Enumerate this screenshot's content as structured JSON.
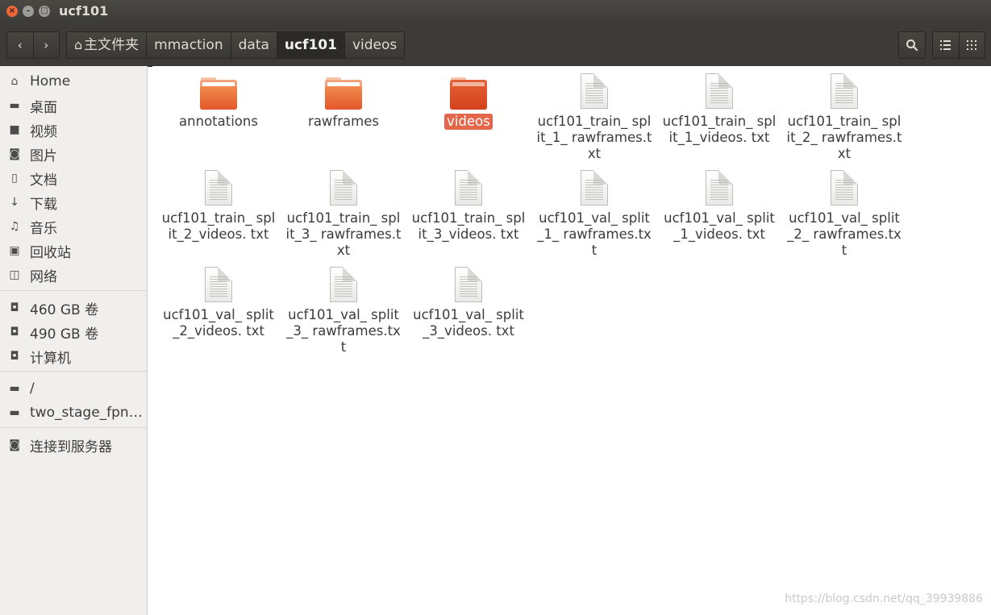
{
  "window": {
    "title": "ucf101",
    "buttons": {
      "close": "×",
      "minimize": "–",
      "maximize": "□"
    }
  },
  "toolbar": {
    "back_icon": "‹",
    "forward_icon": "›",
    "breadcrumb": [
      {
        "label": "主文件夹",
        "icon": "home-icon"
      },
      {
        "label": "mmaction"
      },
      {
        "label": "data"
      },
      {
        "label": "ucf101",
        "active": true
      },
      {
        "label": "videos"
      }
    ],
    "search_icon": "search-icon",
    "view_list_icon": "list-view-icon",
    "view_grid_icon": "grid-view-icon"
  },
  "sidebar": {
    "places": [
      {
        "label": "Home",
        "icon": "home-icon"
      },
      {
        "label": "桌面",
        "icon": "folder-icon"
      },
      {
        "label": "视频",
        "icon": "video-icon"
      },
      {
        "label": "图片",
        "icon": "camera-icon"
      },
      {
        "label": "文档",
        "icon": "document-icon"
      },
      {
        "label": "下载",
        "icon": "download-icon"
      },
      {
        "label": "音乐",
        "icon": "music-icon"
      },
      {
        "label": "回收站",
        "icon": "trash-icon"
      },
      {
        "label": "网络",
        "icon": "network-icon"
      }
    ],
    "devices": [
      {
        "label": "460 GB 卷",
        "icon": "drive-icon"
      },
      {
        "label": "490 GB 卷",
        "icon": "drive-icon"
      },
      {
        "label": "计算机",
        "icon": "drive-icon"
      }
    ],
    "bookmarks": [
      {
        "label": "/",
        "icon": "folder-icon"
      },
      {
        "label": "two_stage_fpn…",
        "icon": "folder-icon"
      }
    ],
    "connect": {
      "label": "连接到服务器",
      "icon": "server-icon"
    }
  },
  "files": [
    {
      "name": "annotations",
      "type": "folder"
    },
    {
      "name": "rawframes",
      "type": "folder"
    },
    {
      "name": "videos",
      "type": "folder",
      "selected": true
    },
    {
      "name": "ucf101_train_ split_1_ rawframes.txt",
      "type": "text"
    },
    {
      "name": "ucf101_train_ split_1_videos. txt",
      "type": "text"
    },
    {
      "name": "ucf101_train_ split_2_ rawframes.txt",
      "type": "text"
    },
    {
      "name": "ucf101_train_ split_2_videos. txt",
      "type": "text"
    },
    {
      "name": "ucf101_train_ split_3_ rawframes.txt",
      "type": "text"
    },
    {
      "name": "ucf101_train_ split_3_videos. txt",
      "type": "text"
    },
    {
      "name": "ucf101_val_ split_1_ rawframes.txt",
      "type": "text"
    },
    {
      "name": "ucf101_val_ split_1_videos. txt",
      "type": "text"
    },
    {
      "name": "ucf101_val_ split_2_ rawframes.txt",
      "type": "text"
    },
    {
      "name": "ucf101_val_ split_2_videos. txt",
      "type": "text"
    },
    {
      "name": "ucf101_val_ split_3_ rawframes.txt",
      "type": "text"
    },
    {
      "name": "ucf101_val_ split_3_videos. txt",
      "type": "text"
    }
  ],
  "watermark": "https://blog.csdn.net/qq_39939886"
}
